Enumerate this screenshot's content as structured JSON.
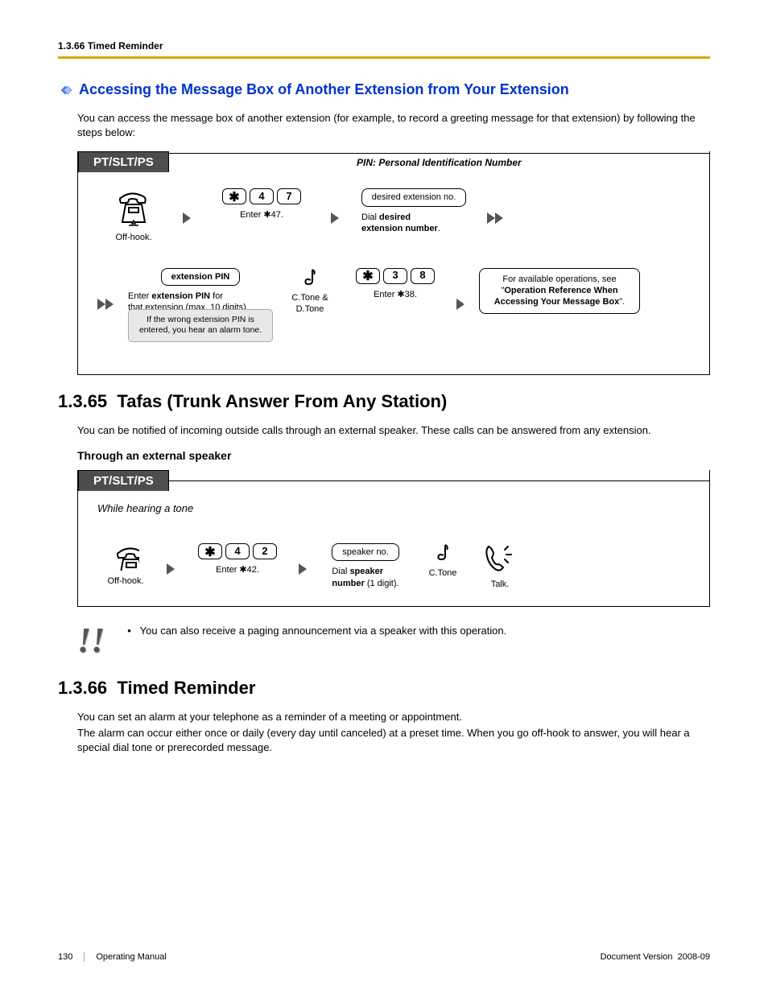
{
  "header": {
    "breadcrumb": "1.3.66 Timed Reminder"
  },
  "section1": {
    "title": "Accessing the Message Box of Another Extension from Your Extension",
    "intro": "You can access the message box of another extension (for example, to record a greeting message for that extension) by following the steps below:",
    "tab": "PT/SLT/PS",
    "pin_note": "PIN: Personal Identification Number",
    "row1": {
      "offhook": "Off-hook.",
      "keys": {
        "k1": "4",
        "k2": "7"
      },
      "enter_star47_a": "Enter ",
      "enter_star47_b": "47.",
      "ext_box": "desired extension no.",
      "dial_a": "Dial ",
      "dial_b": "desired",
      "dial_c": "extension number",
      "dial_d": "."
    },
    "row2": {
      "pin_box": "extension PIN",
      "pin_caption_a": "Enter ",
      "pin_caption_b": "extension PIN",
      "pin_caption_c": " for",
      "pin_caption2": "that extension (max. 10 digits).",
      "callout": "If the wrong extension PIN is entered, you hear an alarm tone.",
      "tone_label1": "C.Tone &",
      "tone_label2": "D.Tone",
      "keys": {
        "k1": "3",
        "k2": "8"
      },
      "enter_star38_a": "Enter ",
      "enter_star38_b": "38.",
      "info_a": "For available operations, see \"",
      "info_b": "Operation Reference When Accessing Your Message Box",
      "info_c": "\"."
    }
  },
  "section2": {
    "number": "1.3.65",
    "title": "Tafas (Trunk Answer From Any Station)",
    "intro": "You can be notified of incoming outside calls through an external speaker. These calls can be answered from any extension.",
    "sub": "Through an external speaker",
    "tab": "PT/SLT/PS",
    "while_note": "While hearing a tone",
    "row": {
      "offhook": "Off-hook.",
      "keys": {
        "k1": "4",
        "k2": "2"
      },
      "enter_star42_a": "Enter ",
      "enter_star42_b": "42.",
      "speaker_box": "speaker no.",
      "dial_a": "Dial ",
      "dial_b": "speaker",
      "dial_c": "number",
      "dial_d": " (1 digit).",
      "ctone": "C.Tone",
      "talk": "Talk."
    },
    "note_bullet": "•",
    "note": "You can also receive a paging announcement via a speaker with this operation."
  },
  "section3": {
    "number": "1.3.66",
    "title": "Timed Reminder",
    "p1": "You can set an alarm at your telephone as a reminder of a meeting or appointment.",
    "p2": "The alarm can occur either once or daily (every day until canceled) at a preset time. When you go off-hook to answer, you will hear a special dial tone or prerecorded message."
  },
  "footer": {
    "page": "130",
    "manual": "Operating Manual",
    "doc_version_label": "Document Version",
    "doc_version": "2008-09"
  }
}
